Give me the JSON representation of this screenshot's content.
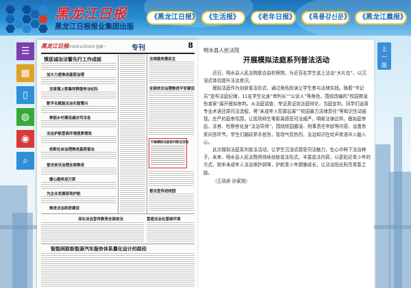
{
  "header": {
    "logo_text": "黑龙江日报",
    "subtitle": "黑龙江日报报业集团出版",
    "nav": [
      {
        "label": "《黑龙江日报》",
        "active": true
      },
      {
        "label": "《生活报》",
        "active": false
      },
      {
        "label": "《老年日报》",
        "active": false
      },
      {
        "label": "《흑룡강신문》",
        "active": false
      },
      {
        "label": "《黑龙江晨报》",
        "active": false
      }
    ]
  },
  "sidebar": {
    "items": [
      {
        "name": "menu",
        "icon": "☰"
      },
      {
        "name": "calendar",
        "icon": "▦"
      },
      {
        "name": "mobile",
        "icon": "▯"
      },
      {
        "name": "wechat",
        "icon": "◍"
      },
      {
        "name": "weibo",
        "icon": "◉"
      },
      {
        "name": "search",
        "icon": "⌕"
      }
    ]
  },
  "newspaper": {
    "logo": "黑龙江日报",
    "date_line": "2024年12月16日 星期一",
    "section": "专刊",
    "page_number": "8",
    "headlines": [
      "慎惩诚治法警先行工作成就",
      "加大力度推进基层治理",
      "龙泉镇上家集党群服务法纪队",
      "数字化赋能法治化智慧兴",
      "美丽乡村建设遍访司法各",
      "法治护航营商环境提质增效",
      "创新社会治理推进基层善治",
      "普法依法治理全面推进",
      "开展模拟法庭系列普法活动",
      "法律服务惠民生",
      "暖心服务进万家",
      "全面依法治理推进平安建设",
      "为企业发展保驾护航",
      "普法宣传进校园",
      "依法护航高质量发展",
      "推进法治政府建设",
      "司法所开展法律援助",
      "深化法治宣传教育全面依法",
      "智能网联新能源汽车服务体系量化设计的路径",
      "营造法治化营商环境"
    ],
    "selected_title": "开展模拟法庭系列普法活动"
  },
  "article": {
    "source": "明水县人民法院",
    "title": "开展模拟法庭系列普法活动",
    "paragraphs": [
      "近日，明水县人民法院联合县检察院，为近百名学生送上法治“大礼包”，以沉浸式体验提升法治意识。",
      "模拟法庭作为创新普法形式，通过角色扮演让学生参与法律实践。随着“书记员”宣布法庭纪律，11名学生化身“审判长”“公诉人”等角色，围绕改编的“校园欺凌伤害案”展开模拟审判。从法庭调查、举证质证到法庭辩论，当庭宣判，同学们运用专业术语还原司法流程，将“未成年人犯罪后果”“校园暴力法律责任”等知识生动展现。庄严的庭审氛围，让现场师生零距离感受司法威严，明晰法律边界。模拟庭审后，法官、检察官化身“法治导师”，围绕校园霸凌、刑事责任年龄等内容，设置有奖问答环节。学生们踊跃举手抢答，现场气氛热烈，法治知识在欢声笑语中入脑入心。",
      "此次模拟法庭系列普法活动，让学生沉浸式感受司法魅力，在心中种下法治种子。未来，明水县人民法院将持续创新普法形式，丰富普法内容，以更贴近青少年的方式，筑牢未成年人法治保护屏障，护航青少年健康成长，让法治阳光照亮青春之路。"
    ],
    "author": "（王凤娇 孙家旭）"
  },
  "page_switch": {
    "line1": "上",
    "line2": "一",
    "line3": "版"
  }
}
